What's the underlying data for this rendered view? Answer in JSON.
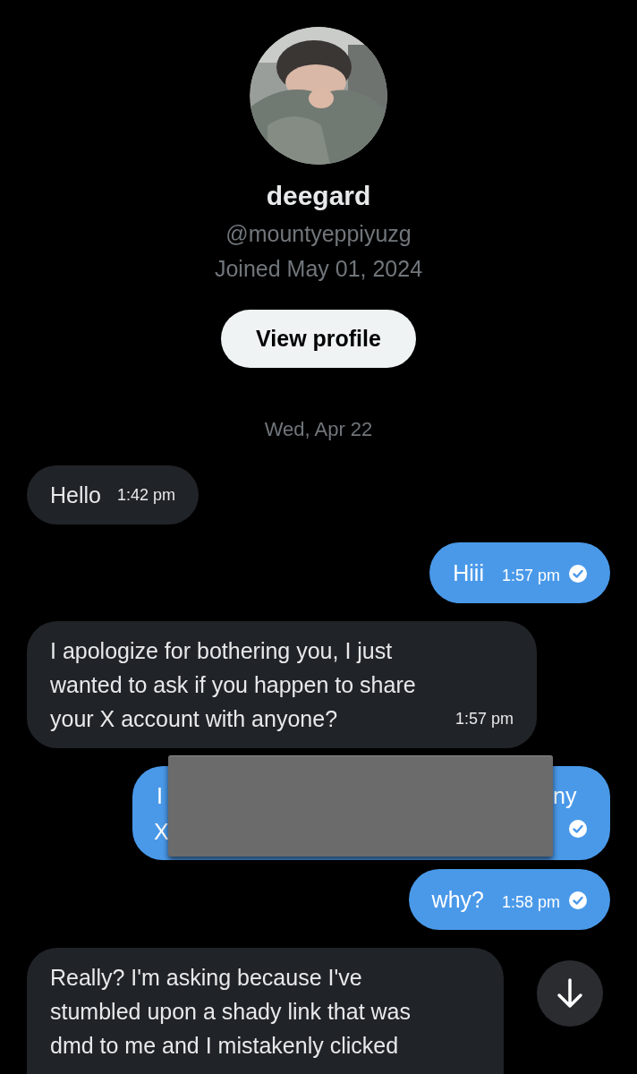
{
  "profile": {
    "name": "deegard",
    "handle": "@mountyeppiyuzg",
    "joined": "Joined May 01, 2024",
    "button": "View profile"
  },
  "date_separator": "Wed, Apr 22",
  "messages": [
    {
      "kind": "received",
      "text": "Hello",
      "time": "1:42 pm"
    },
    {
      "kind": "sent",
      "text": "Hiii",
      "time": "1:57 pm",
      "read": true
    },
    {
      "kind": "received",
      "text": "I apologize for bothering you, I just wanted to ask if you happen to share your X account with anyone?",
      "time": "1:57 pm"
    },
    {
      "kind": "redacted_sent",
      "fragments": [
        "I",
        "ny",
        "X"
      ],
      "read": true
    },
    {
      "kind": "sent",
      "text": "why?",
      "time": "1:58 pm",
      "read": true
    },
    {
      "kind": "received",
      "text": "Really? I'm asking because I've stumbled upon a shady link that was dmd to me and I mistakenly clicked"
    }
  ]
}
